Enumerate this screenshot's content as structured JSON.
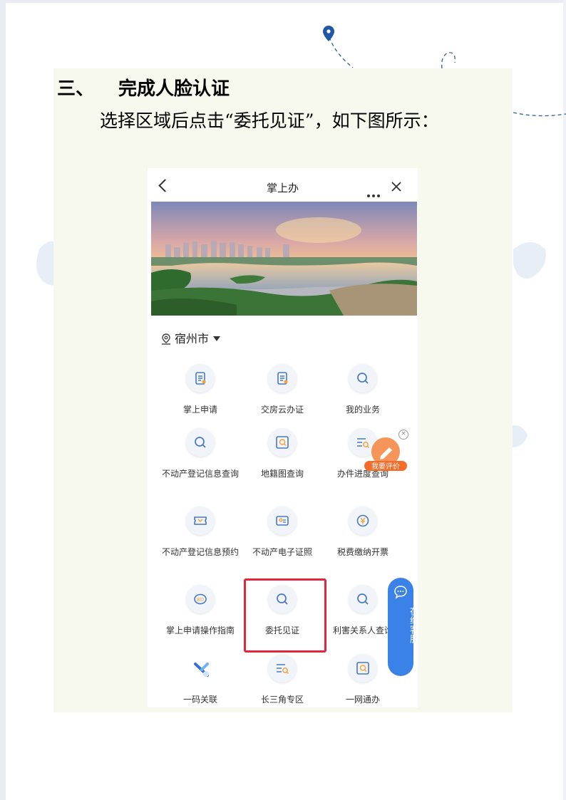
{
  "document": {
    "section_number": "三、",
    "section_title": "完成人脸认证",
    "instruction": "选择区域后点击“委托见证”，如下图所示："
  },
  "phone": {
    "app_title": "掌上办",
    "city": "宿州市",
    "grid": [
      {
        "label": "掌上申请",
        "icon": "document-icon"
      },
      {
        "label": "交房云办证",
        "icon": "document-icon"
      },
      {
        "label": "我的业务",
        "icon": "search-icon"
      },
      {
        "label": "不动产登记信息查询",
        "icon": "search-icon"
      },
      {
        "label": "地籍图查询",
        "icon": "map-search-icon"
      },
      {
        "label": "办件进度查询",
        "icon": "list-search-icon"
      },
      {
        "label": "不动产登记信息预约",
        "icon": "ticket-icon"
      },
      {
        "label": "不动产电子证照",
        "icon": "certificate-icon"
      },
      {
        "label": "税费缴纳开票",
        "icon": "payment-icon"
      },
      {
        "label": "掌上申请操作指南",
        "icon": "guide-icon"
      },
      {
        "label": "委托见证",
        "icon": "search-icon"
      },
      {
        "label": "利害关系人查询",
        "icon": "search-icon"
      },
      {
        "label": "一码关联",
        "icon": "link-icon"
      },
      {
        "label": "长三角专区",
        "icon": "list-search-icon"
      },
      {
        "label": "一网通办",
        "icon": "map-search-icon"
      }
    ],
    "eval_badge": "我要评价",
    "online_service": "在线客服"
  },
  "colors": {
    "accent_blue": "#3b82e8",
    "highlight_red": "#e1263f",
    "badge_orange": "#f46b2a",
    "panel_bg": "#f7f9ee"
  }
}
